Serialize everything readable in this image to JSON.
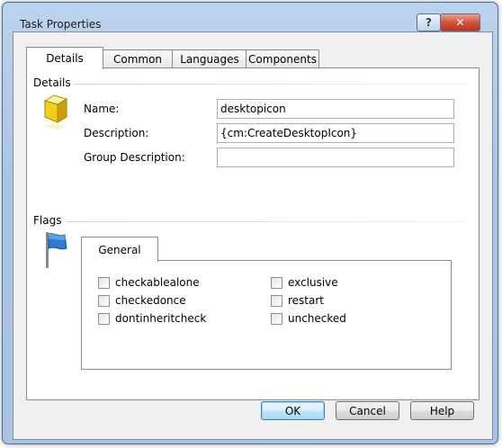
{
  "window": {
    "title": "Task Properties",
    "help_glyph": "?",
    "close_glyph": "✕"
  },
  "tabs": [
    {
      "label": "Details",
      "active": true
    },
    {
      "label": "Common"
    },
    {
      "label": "Languages"
    },
    {
      "label": "Components"
    }
  ],
  "details": {
    "section_label": "Details",
    "fields": [
      {
        "label": "Name:",
        "value": "desktopicon"
      },
      {
        "label": "Description:",
        "value": "{cm:CreateDesktopIcon}"
      },
      {
        "label": "Group Description:",
        "value": ""
      }
    ]
  },
  "flags": {
    "section_label": "Flags",
    "inner_tab": "General",
    "checkboxes_left": [
      {
        "label": "checkablealone",
        "checked": false
      },
      {
        "label": "checkedonce",
        "checked": false
      },
      {
        "label": "dontinheritcheck",
        "checked": false
      }
    ],
    "checkboxes_right": [
      {
        "label": "exclusive",
        "checked": false
      },
      {
        "label": "restart",
        "checked": false
      },
      {
        "label": "unchecked",
        "checked": false
      }
    ]
  },
  "buttons": {
    "ok": "OK",
    "cancel": "Cancel",
    "help": "Help"
  },
  "colors": {
    "accent": "#3c7fb1",
    "title_bar": "#bcd3ec",
    "client_bg": "#f0f0f0",
    "close": "#c2321a"
  },
  "icons": {
    "details": "cube-icon",
    "flags": "flag-icon"
  }
}
